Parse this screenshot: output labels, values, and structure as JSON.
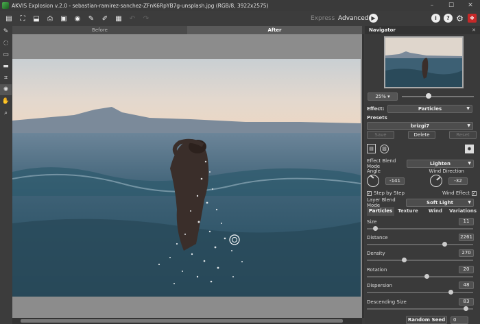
{
  "window": {
    "title": "AKVIS Explosion v.2.0 - sebastian-ramirez-sanchez-ZFnK6RpYB7g-unsplash.jpg (RGB/8, 3922x2575)"
  },
  "toolbar": {
    "express": "Express",
    "advanced": "Advanced"
  },
  "tabs": {
    "before": "Before",
    "after": "After"
  },
  "navigator": {
    "title": "Navigator",
    "zoom": "25%",
    "zoom_level_fraction": 0.35
  },
  "effect": {
    "label": "Effect:",
    "value": "Particles"
  },
  "presets": {
    "label": "Presets",
    "value": "brizgi7",
    "save": "Save",
    "delete": "Delete",
    "reset": "Reset"
  },
  "blend": {
    "effect_label": "Effect Blend Mode",
    "effect_value": "Lighten",
    "layer_label": "Layer Blend Mode",
    "layer_value": "Soft Light"
  },
  "angle": {
    "label": "Angle",
    "value": "-141"
  },
  "wind_direction": {
    "label": "Wind Direction",
    "value": "-32"
  },
  "step_by_step": {
    "label": "Step by Step",
    "checked": true
  },
  "wind_effect": {
    "label": "Wind Effect",
    "checked": true
  },
  "subtabs": [
    "Particles",
    "Texture",
    "Wind",
    "Variations"
  ],
  "params": [
    {
      "label": "Size",
      "value": "11",
      "fraction": 0.06
    },
    {
      "label": "Distance",
      "value": "2261",
      "fraction": 0.73
    },
    {
      "label": "Density",
      "value": "270",
      "fraction": 0.34
    },
    {
      "label": "Rotation",
      "value": "20",
      "fraction": 0.56
    },
    {
      "label": "Dispersion",
      "value": "48",
      "fraction": 0.79
    },
    {
      "label": "Descending Size",
      "value": "83",
      "fraction": 0.94
    }
  ],
  "random_seed": {
    "label": "Random Seed",
    "value": "0"
  },
  "icons": {
    "express_run": "play-icon",
    "info": "info-icon",
    "help": "help-icon",
    "settings": "gear-icon",
    "gift": "gift-icon"
  }
}
